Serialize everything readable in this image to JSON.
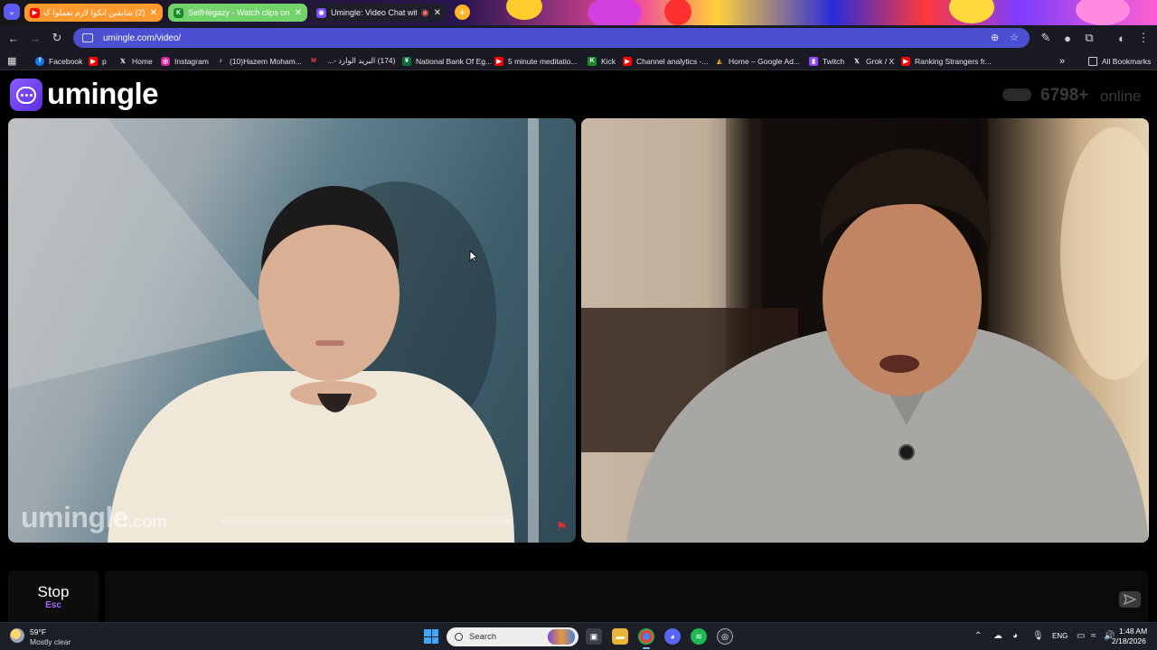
{
  "browser": {
    "tabs": [
      {
        "title": "(2) شايفين انكوا لازم تعملوا كدا",
        "favicon": "youtube-icon",
        "color": "#ff9a2e"
      },
      {
        "title": "SelfHegazy - Watch clips on Kick",
        "favicon": "kick-icon",
        "color": "#72d36a"
      },
      {
        "title": "Umingle: Video Chat with S",
        "favicon": "umingle-icon",
        "color": "#1f1f2a"
      }
    ],
    "url": "umingle.com/video/",
    "bookmarks": [
      {
        "label": "Facebook",
        "icon": "facebook-icon",
        "color": "#1877f2"
      },
      {
        "label": "p",
        "icon": "youtube-icon",
        "color": "#ff0000"
      },
      {
        "label": "Home",
        "icon": "x-icon",
        "color": "#000000"
      },
      {
        "label": "Instagram",
        "icon": "instagram-icon",
        "color": "#d6249f"
      },
      {
        "label": "(10)Hazem Moham...",
        "icon": "tiktok-icon",
        "color": "#000000"
      },
      {
        "label": "",
        "icon": "gmail-icon",
        "color": "#ea4335"
      },
      {
        "label": "(174) البريد الوارد -...",
        "icon": "outlook-icon",
        "color": "#0f6cbd"
      },
      {
        "label": "National Bank Of Eg...",
        "icon": "bank-icon",
        "color": "#0b6b3a"
      },
      {
        "label": "5 minute meditatio...",
        "icon": "youtube-icon",
        "color": "#ff0000"
      },
      {
        "label": "Kick",
        "icon": "kick-icon",
        "color": "#53fc18"
      },
      {
        "label": "Channel analytics -...",
        "icon": "youtube-icon",
        "color": "#ff0000"
      },
      {
        "label": "Home – Google Ad...",
        "icon": "google-ads-icon",
        "color": "#fbbc04"
      },
      {
        "label": "Twitch",
        "icon": "twitch-icon",
        "color": "#9146ff"
      },
      {
        "label": "Grok / X",
        "icon": "x-icon",
        "color": "#000000"
      },
      {
        "label": "Ranking Strangers fr...",
        "icon": "youtube-icon",
        "color": "#ff0000"
      }
    ],
    "all_bookmarks": "All Bookmarks"
  },
  "site": {
    "brand": "umingle",
    "online_count": "6798+",
    "online_label": "online",
    "watermark_brand": "umingle",
    "watermark_domain": ".com",
    "stop_label": "Stop",
    "stop_hint": "Esc",
    "accent": "#7c4dff"
  },
  "taskbar": {
    "weather_temp": "59°F",
    "weather_desc": "Mostly clear",
    "search_label": "Search",
    "language": "ENG",
    "time": "1:48 AM",
    "date": "2/18/2026"
  }
}
